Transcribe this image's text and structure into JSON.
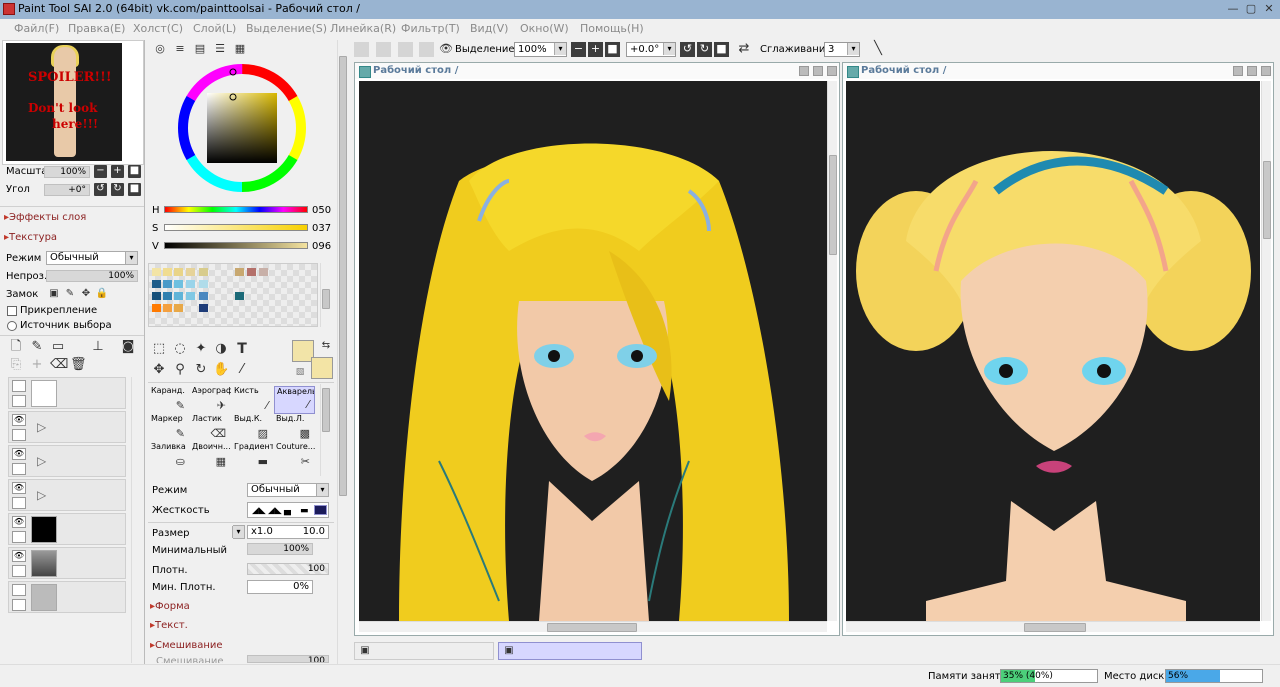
{
  "window": {
    "title": "Paint Tool SAI 2.0 (64bit) vk.com/painttoolsai - Рабочий стол /",
    "minimize": "—",
    "maximize": "▢",
    "close": "✕"
  },
  "menu": [
    "Файл(F)",
    "Правка(E)",
    "Холст(C)",
    "Слой(L)",
    "Выделение(S)",
    "Линейка(R)",
    "Фильтр(T)",
    "Вид(V)",
    "Окно(W)",
    "Помощь(H)"
  ],
  "navigator": {
    "thumb_text_1": "SPOILER!!!",
    "thumb_text_2": "Don't look",
    "thumb_text_3": "here!!!",
    "zoom_label": "Масштаб",
    "zoom_value": "100%",
    "angle_label": "Угол",
    "angle_value": "+0°"
  },
  "layer_panel": {
    "effects": "Эффекты слоя",
    "texture": "Текстура",
    "mode_label": "Режим",
    "mode_value": "Обычный",
    "opacity_label": "Непроз.",
    "opacity_value": "100%",
    "lock_label": "Замок",
    "clip_label": "Прикрепление",
    "source_label": "Источник выбора"
  },
  "color_panel": {
    "h_label": "H",
    "h_value": "050",
    "s_label": "S",
    "s_value": "037",
    "v_label": "V",
    "v_value": "096",
    "current_color": "#f2e4a8",
    "secondary_color": "#f3e4a5"
  },
  "tools": [
    {
      "label": "Каранд.",
      "icon": "pencil-icon"
    },
    {
      "label": "Аэрограф",
      "icon": "airbrush-icon"
    },
    {
      "label": "Кисть",
      "icon": "brush-icon"
    },
    {
      "label": "Акварель",
      "icon": "watercolor-icon"
    },
    {
      "label": "Маркер",
      "icon": "marker-icon"
    },
    {
      "label": "Ластик",
      "icon": "eraser-icon"
    },
    {
      "label": "Выд.К.",
      "icon": "select-pen-icon"
    },
    {
      "label": "Выд.Л.",
      "icon": "select-eraser-icon"
    },
    {
      "label": "Заливка",
      "icon": "bucket-icon"
    },
    {
      "label": "Двоичн...",
      "icon": "binary-icon"
    },
    {
      "label": "Градиент",
      "icon": "gradient-icon"
    },
    {
      "label": "Couture...",
      "icon": "couture-icon"
    }
  ],
  "brush": {
    "mode_label": "Режим",
    "mode_value": "Обычный",
    "hardness_label": "Жесткость",
    "size_label": "Размер",
    "size_mult": "x1.0",
    "size_value": "10.0",
    "min_label": "Минимальный",
    "min_value": "100%",
    "density_label": "Плотн.",
    "density_value": "100",
    "min_density_label": "Мин. Плотн.",
    "min_density_value": "0%",
    "shape_label": "Форма",
    "texture_label": "Текст.",
    "blend_label": "Смешивание",
    "blend_sub_label": "Смешивание",
    "blend_sub_value": "100"
  },
  "toolbar": {
    "selection_label": "Выделение",
    "zoom_value": "100%",
    "angle_value": "+0.0°",
    "smoothing_label": "Сглаживание",
    "smoothing_value": "3"
  },
  "canvases": [
    {
      "title": "Рабочий стол /"
    },
    {
      "title": "Рабочий стол /"
    }
  ],
  "status": {
    "memory_label": "Памяти занято",
    "memory_value": "35% (40%)",
    "memory_pct": 35,
    "disk_label": "Место диска",
    "disk_value": "56%",
    "disk_pct": 56
  },
  "colors": {
    "titlebar": "#99b4d1",
    "accent_section": "#8b1f1f",
    "canvas_bg": "#1f1f1f",
    "memory_fill": "#4ccf7a",
    "disk_fill": "#4aa8e8"
  }
}
